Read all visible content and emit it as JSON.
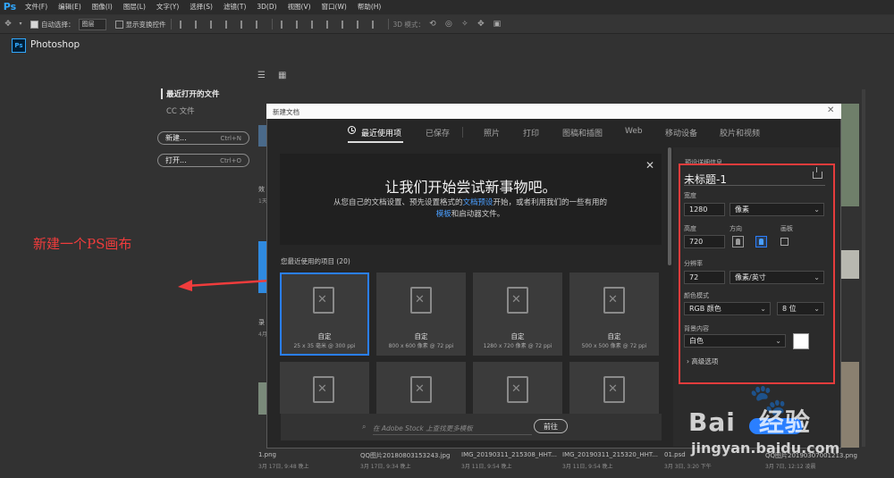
{
  "app": {
    "logo": "Ps"
  },
  "menu": [
    "文件(F)",
    "编辑(E)",
    "图像(I)",
    "图层(L)",
    "文字(Y)",
    "选择(S)",
    "滤镜(T)",
    "3D(D)",
    "视图(V)",
    "窗口(W)",
    "帮助(H)"
  ],
  "options_bar": {
    "auto_select_label": "自动选择：",
    "auto_select_value": "图层",
    "transform_label": "显示变换控件",
    "mode_3d_label": "3D 模式："
  },
  "home": {
    "title": "Photoshop",
    "ps_icon": "Ps",
    "recent_label": "最近打开的文件",
    "cc_label": "CC 文件",
    "new_label": "新建...",
    "new_shortcut": "Ctrl+N",
    "open_label": "打开...",
    "open_shortcut": "Ctrl+O",
    "bg_fragments": [
      "效",
      "1天",
      "录",
      "4月"
    ],
    "bottom_files": [
      {
        "name": "1.png",
        "date": "3月 17日, 9:48 晚上"
      },
      {
        "name": "QQ图片20180803153243.jpg",
        "date": "3月 17日, 9:34 晚上"
      },
      {
        "name": "IMG_20190311_215308_HHT...",
        "date": "3月 11日, 9:54 晚上"
      },
      {
        "name": "IMG_20190311_215320_HHT...",
        "date": "3月 11日, 9:54 晚上"
      },
      {
        "name": "01.psd",
        "date": "3月 3日, 3:20 下午"
      },
      {
        "name": "QQ图片20190307001213.png",
        "date": "3月 7日, 12:12 凌晨"
      }
    ]
  },
  "annotation": {
    "text": "新建一个PS画布",
    "color": "#f03c3c"
  },
  "dialog": {
    "title": "新建文档",
    "tabs": [
      "最近使用项",
      "已保存",
      "照片",
      "打印",
      "图稿和插图",
      "Web",
      "移动设备",
      "胶片和视频"
    ],
    "banner": {
      "title": "让我们开始尝试新事物吧。",
      "text_1": "从您自己的文档设置、预先设置格式的",
      "link_1": "文档预设",
      "text_2": "开始，或者利用我们的一些有用的",
      "link_2": "模板",
      "text_3": "和启动器文件。"
    },
    "recent_heading": "您最近使用的项目  (20)",
    "cards": [
      {
        "name": "自定",
        "desc": "25 x 35 毫米 @ 300 ppi"
      },
      {
        "name": "自定",
        "desc": "800 x 600 像素 @ 72 ppi"
      },
      {
        "name": "自定",
        "desc": "1280 x 720 像素 @ 72 ppi"
      },
      {
        "name": "自定",
        "desc": "500 x 500 像素 @ 72 ppi"
      }
    ],
    "stock_placeholder": "在 Adobe Stock 上查找更多模板",
    "go_label": "前往"
  },
  "details": {
    "section_label": "预设详细信息",
    "doc_name": "未标题-1",
    "width_label": "宽度",
    "width_value": "1280",
    "width_unit": "像素",
    "height_label": "高度",
    "height_value": "720",
    "orientation_label": "方向",
    "artboard_label": "画板",
    "resolution_label": "分辨率",
    "resolution_value": "72",
    "resolution_unit": "像素/英寸",
    "color_mode_label": "颜色模式",
    "color_mode_value": "RGB 颜色",
    "bit_depth": "8 位",
    "background_label": "背景内容",
    "background_value": "白色",
    "advanced_label": "高级选项"
  },
  "watermark": {
    "brand": "Bai",
    "brand_cn": "经验",
    "url": "jingyan.baidu.com"
  }
}
